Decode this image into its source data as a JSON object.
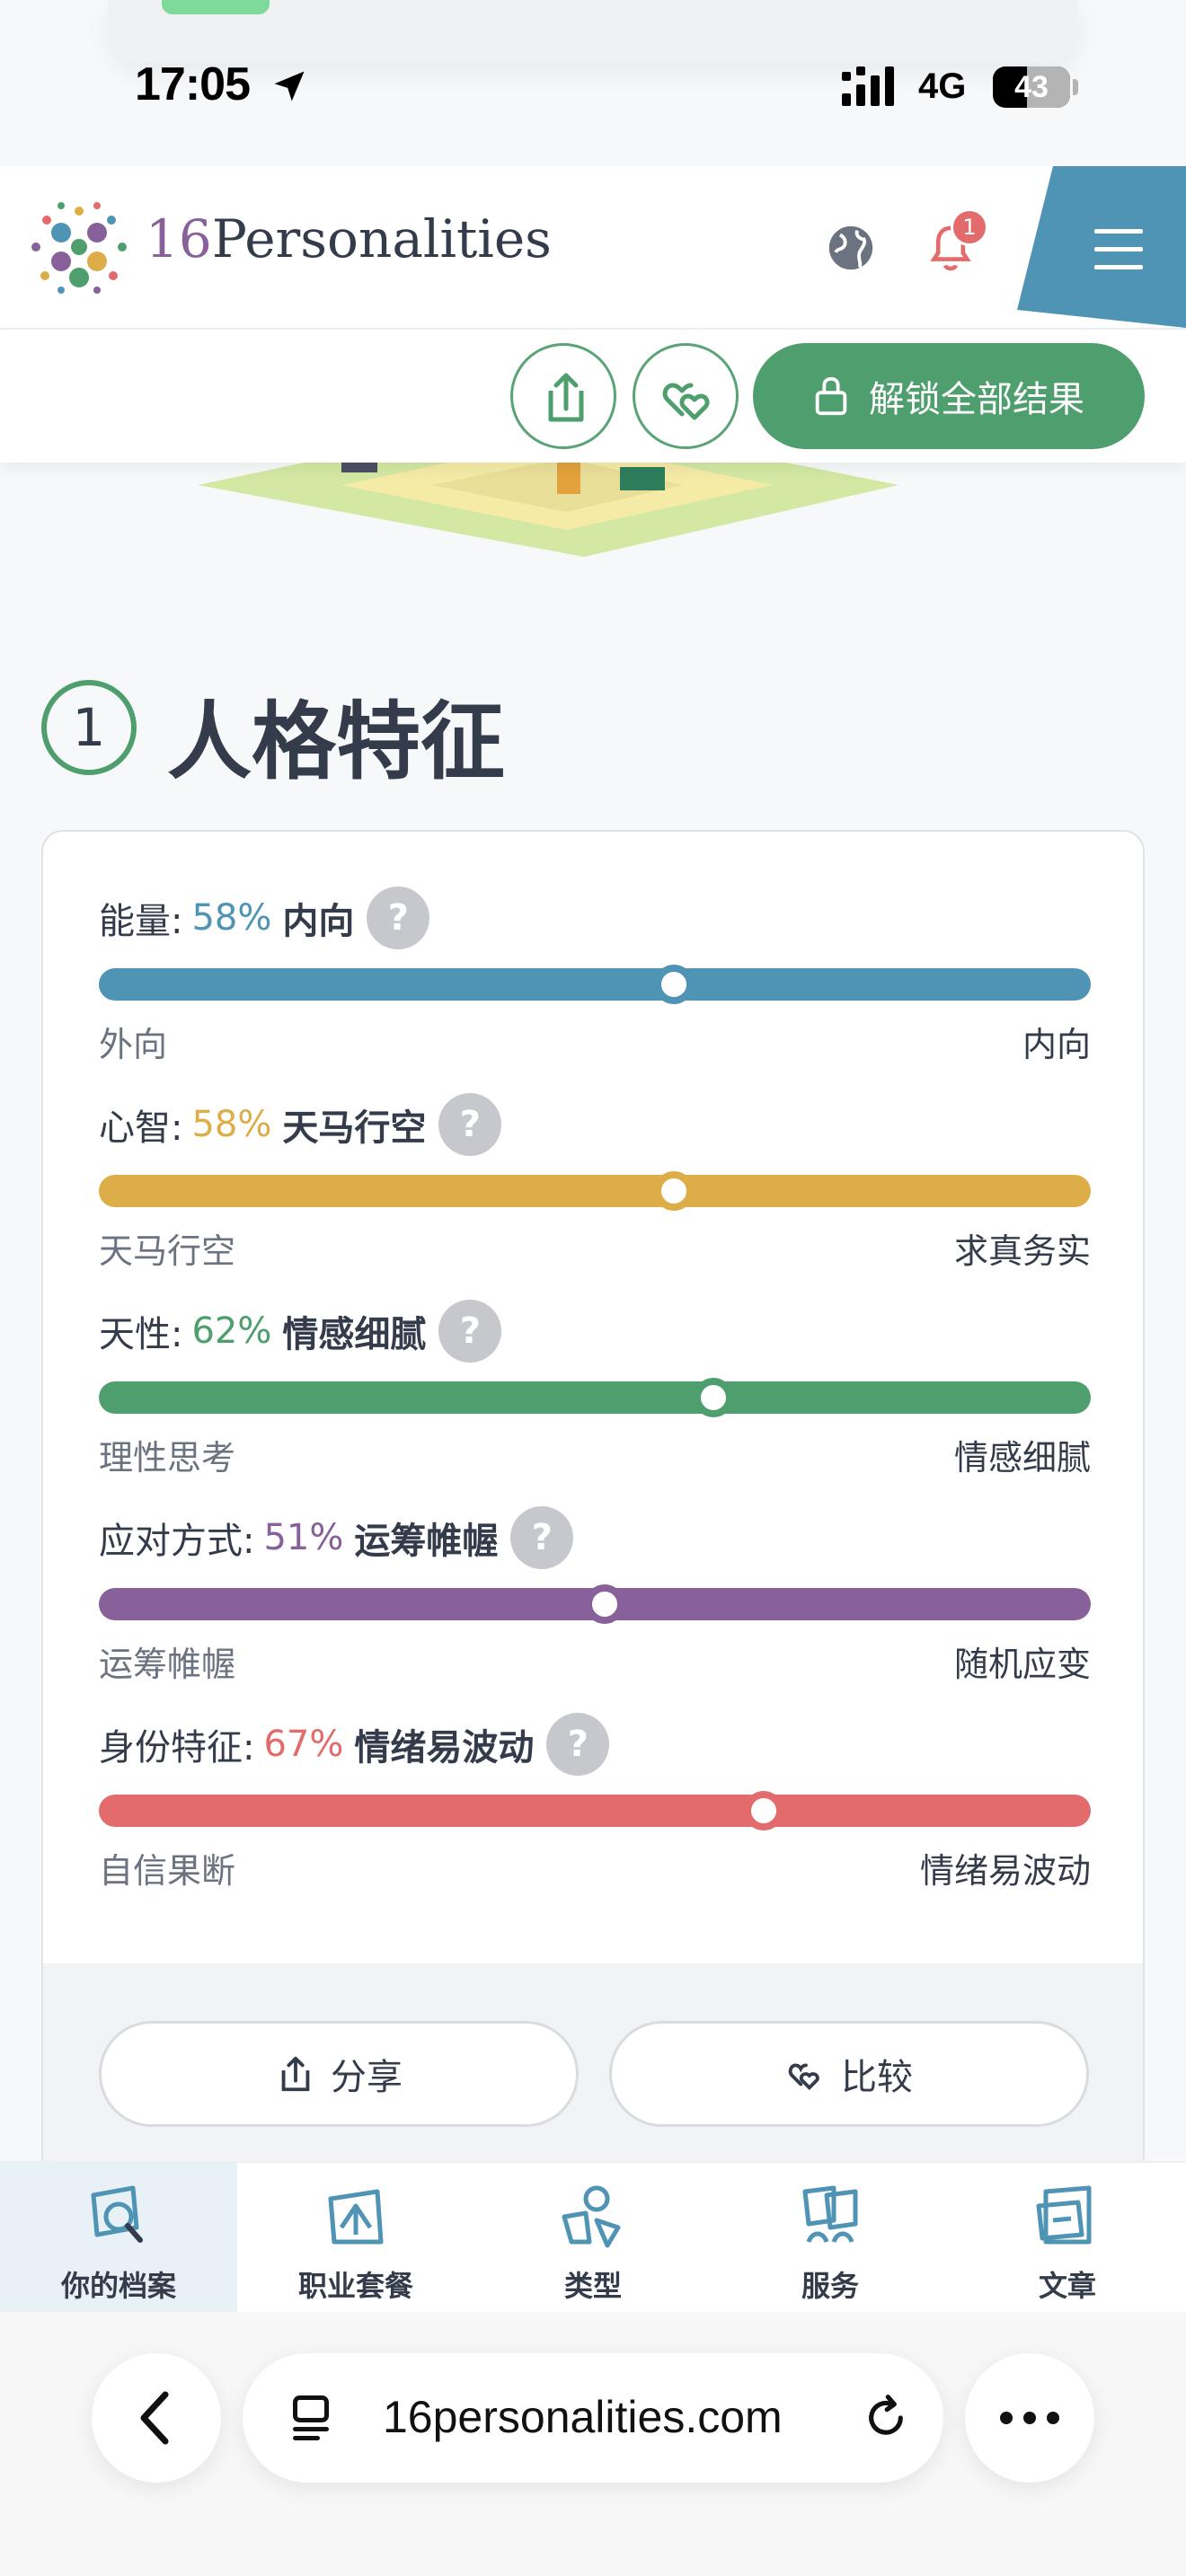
{
  "status_bar": {
    "time": "17:05",
    "network": "4G",
    "battery": "43"
  },
  "header": {
    "logo_number": "16",
    "logo_word": "Personalities",
    "notification_count": "1"
  },
  "action_bar": {
    "unlock_label": "解锁全部结果"
  },
  "section": {
    "number": "1",
    "title": "人格特征"
  },
  "traits": [
    {
      "name": "能量:",
      "percent": "58%",
      "value": 58,
      "side": "内向",
      "left_label": "外向",
      "right_label": "内向",
      "color": "#4f93b5"
    },
    {
      "name": "心智:",
      "percent": "58%",
      "value": 58,
      "side": "天马行空",
      "left_label": "天马行空",
      "right_label": "求真务实",
      "color": "#ddae48"
    },
    {
      "name": "天性:",
      "percent": "62%",
      "value": 62,
      "side": "情感细腻",
      "left_label": "理性思考",
      "right_label": "情感细腻",
      "color": "#4f9f6e"
    },
    {
      "name": "应对方式:",
      "percent": "51%",
      "value": 51,
      "side": "运筹帷幄",
      "left_label": "运筹帷幄",
      "right_label": "随机应变",
      "color": "#88619a"
    },
    {
      "name": "身份特征:",
      "percent": "67%",
      "value": 67,
      "side": "情绪易波动",
      "left_label": "自信果断",
      "right_label": "情绪易波动",
      "color": "#e46b6b"
    }
  ],
  "card_buttons": {
    "share": "分享",
    "compare": "比较"
  },
  "bottom_nav": [
    {
      "label": "你的档案",
      "icon": "profile-search-icon",
      "active": true
    },
    {
      "label": "职业套餐",
      "icon": "career-icon",
      "active": false
    },
    {
      "label": "类型",
      "icon": "types-icon",
      "active": false
    },
    {
      "label": "服务",
      "icon": "services-icon",
      "active": false
    },
    {
      "label": "文章",
      "icon": "articles-icon",
      "active": false
    }
  ],
  "browser": {
    "url": "16personalities.com"
  }
}
